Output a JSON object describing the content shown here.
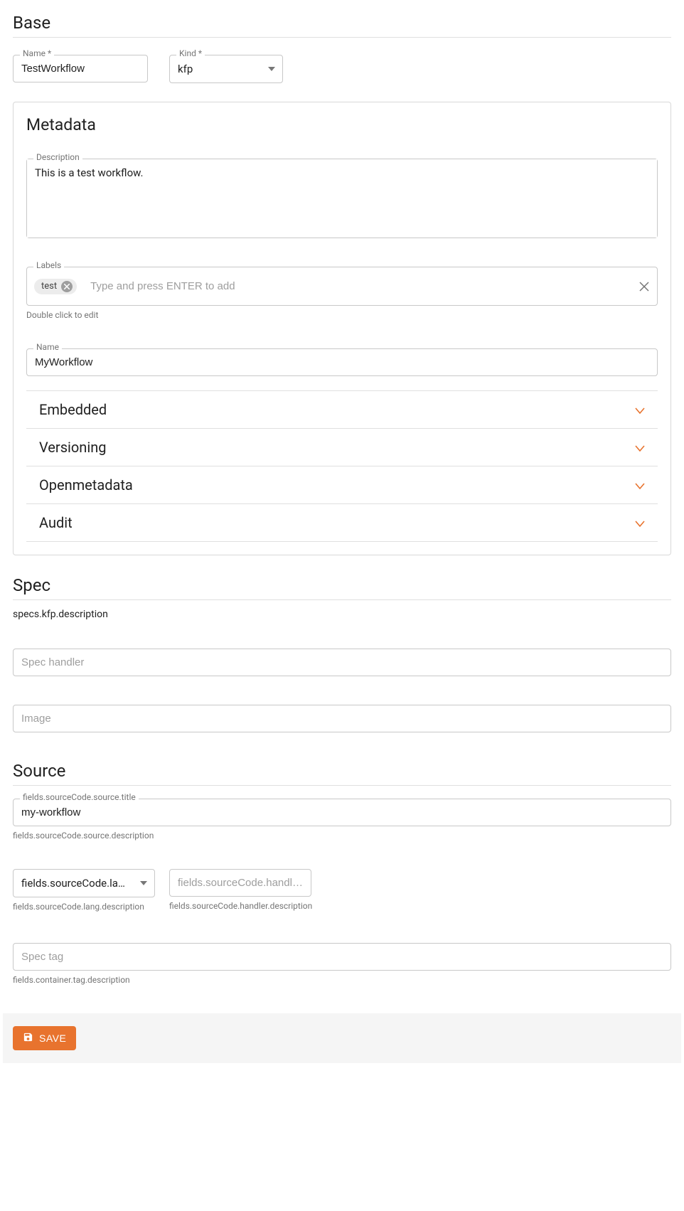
{
  "base": {
    "title": "Base",
    "name_label": "Name *",
    "name_value": "TestWorkflow",
    "kind_label": "Kind *",
    "kind_value": "kfp"
  },
  "metadata": {
    "title": "Metadata",
    "description_label": "Description",
    "description_value": "This is a test workflow.",
    "labels_label": "Labels",
    "labels_chips": [
      {
        "text": "test"
      }
    ],
    "labels_placeholder": "Type and press ENTER to add",
    "labels_helper": "Double click to edit",
    "name_label": "Name",
    "name_value": "MyWorkflow",
    "accordions": [
      {
        "title": "Embedded"
      },
      {
        "title": "Versioning"
      },
      {
        "title": "Openmetadata"
      },
      {
        "title": "Audit"
      }
    ]
  },
  "spec": {
    "title": "Spec",
    "description": "specs.kfp.description",
    "handler_placeholder": "Spec handler",
    "image_placeholder": "Image"
  },
  "source": {
    "title": "Source",
    "source_title_label": "fields.sourceCode.source.title",
    "source_title_value": "my-workflow",
    "source_title_helper": "fields.sourceCode.source.description",
    "lang_placeholder": "fields.sourceCode.lang.t…",
    "lang_helper": "fields.sourceCode.lang.description",
    "handler_placeholder": "fields.sourceCode.handler.…",
    "handler_helper": "fields.sourceCode.handler.description",
    "tag_placeholder": "Spec tag",
    "tag_helper": "fields.container.tag.description"
  },
  "footer": {
    "save_label": "SAVE"
  }
}
